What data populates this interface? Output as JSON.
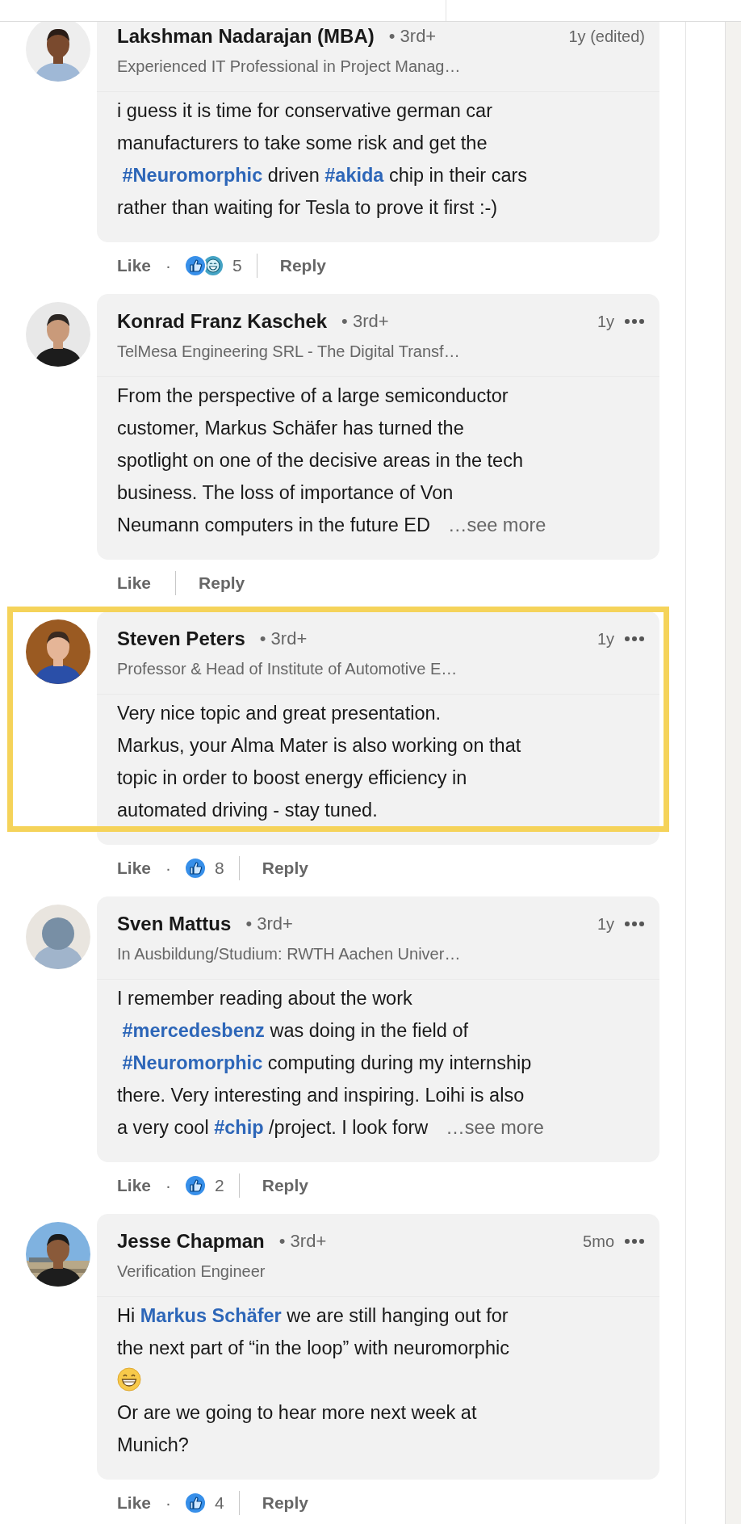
{
  "comments": [
    {
      "name": "Lakshman Nadarajan (MBA)",
      "degree": "• 3rd+",
      "time": "1y (edited)",
      "menu": false,
      "headline": "Experienced IT Professional in Project Manag…",
      "avatar": {
        "kind": "picture"
      },
      "highlighted": false,
      "body": [
        {
          "kind": "text",
          "text": "i guess it is time for conservative german car\nmanufacturers to take some risk and get the\n "
        },
        {
          "kind": "hashtag",
          "text": "#Neuromorphic"
        },
        {
          "kind": "text",
          "text": " driven "
        },
        {
          "kind": "hashtag",
          "text": "#akida"
        },
        {
          "kind": "text",
          "text": " chip in their cars\nrather than waiting for Tesla to prove it first :-)"
        }
      ],
      "like": "Like",
      "dot": "·",
      "reactions": [
        {
          "kind": "like"
        },
        {
          "kind": "funny"
        }
      ],
      "reaction_count": "5",
      "reply": "Reply"
    },
    {
      "name": "Konrad Franz Kaschek",
      "degree": "• 3rd+",
      "time": "1y",
      "menu": true,
      "headline": "TelMesa Engineering SRL - The Digital Transf…",
      "avatar": {
        "kind": "picture"
      },
      "highlighted": false,
      "body": [
        {
          "kind": "text",
          "text": "From the perspective of a large semiconductor\ncustomer, Markus Schäfer has turned the\nspotlight on one of the decisive areas in the tech\nbusiness. The loss of importance of Von\nNeumann computers in the future ED"
        },
        {
          "kind": "more",
          "text": "…see more"
        }
      ],
      "like": "Like",
      "reply": "Reply"
    },
    {
      "name": "Steven Peters",
      "degree": "• 3rd+",
      "time": "1y",
      "menu": true,
      "headline": "Professor & Head of Institute of Automotive E…",
      "avatar": {
        "kind": "picture"
      },
      "highlighted": true,
      "body": [
        {
          "kind": "text",
          "text": "Very nice topic and great presentation.\nMarkus, your Alma Mater is also working on that\ntopic in order to boost energy efficiency in\nautomated driving - stay tuned."
        }
      ],
      "like": "Like",
      "dot": "·",
      "reactions": [
        {
          "kind": "like"
        }
      ],
      "reaction_count": "8",
      "reply": "Reply"
    },
    {
      "name": "Sven Mattus",
      "degree": "• 3rd+",
      "time": "1y",
      "menu": true,
      "headline": "In Ausbildung/Studium: RWTH Aachen Univer…",
      "avatar": {
        "kind": "default"
      },
      "highlighted": false,
      "body": [
        {
          "kind": "text",
          "text": "I remember reading about the work\n "
        },
        {
          "kind": "hashtag",
          "text": "#mercedesbenz"
        },
        {
          "kind": "text",
          "text": " was doing in the field of\n "
        },
        {
          "kind": "hashtag",
          "text": "#Neuromorphic"
        },
        {
          "kind": "text",
          "text": " computing during my internship\nthere. Very interesting and inspiring. Loihi is also\na very cool "
        },
        {
          "kind": "hashtag",
          "text": "#chip"
        },
        {
          "kind": "text",
          "text": " /project. I look forw"
        },
        {
          "kind": "more",
          "text": "…see more"
        }
      ],
      "like": "Like",
      "dot": "·",
      "reactions": [
        {
          "kind": "like"
        }
      ],
      "reaction_count": "2",
      "reply": "Reply"
    },
    {
      "name": "Jesse Chapman",
      "degree": "• 3rd+",
      "time": "5mo",
      "menu": true,
      "headline": "Verification Engineer",
      "avatar": {
        "kind": "picture"
      },
      "highlighted": false,
      "body": [
        {
          "kind": "text",
          "text": "Hi "
        },
        {
          "kind": "mention",
          "text": "Markus Schäfer"
        },
        {
          "kind": "text",
          "text": " we are still hanging out for\nthe next part of “in the loop” with neuromorphic\n"
        },
        {
          "kind": "emoji"
        },
        {
          "kind": "text",
          "text": "\nOr are we going to hear more next week at\nMunich?"
        }
      ],
      "like": "Like",
      "dot": "·",
      "reactions": [
        {
          "kind": "like"
        }
      ],
      "reaction_count": "4",
      "reply": "Reply"
    }
  ]
}
